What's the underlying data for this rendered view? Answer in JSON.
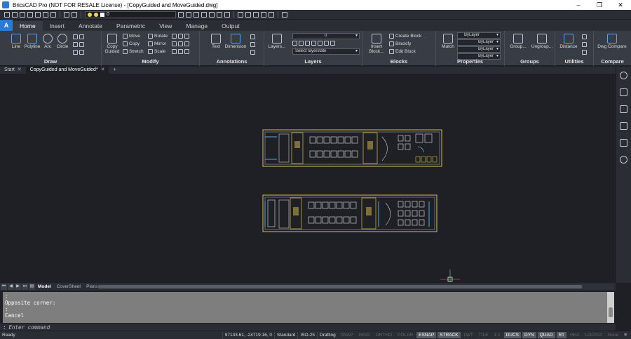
{
  "window": {
    "title": "BricsCAD Pro (NOT FOR RESALE License) - [CopyGuided and MoveGuided.dwg]",
    "minimize": "–",
    "maximize": "❐",
    "close": "✕"
  },
  "quick_access": {
    "layer_value": "0"
  },
  "ribbon_tabs": [
    "Home",
    "Insert",
    "Annotate",
    "Parametric",
    "View",
    "Manage",
    "Output"
  ],
  "ribbon": {
    "draw": {
      "title": "Draw",
      "tools": [
        "Line",
        "Polyline",
        "Arc",
        "Circle"
      ]
    },
    "modify": {
      "title": "Modify",
      "copy_guided": "Copy Guided",
      "items": [
        "Move",
        "Copy",
        "Stretch",
        "Rotate",
        "Mirror",
        "Scale"
      ]
    },
    "annotations": {
      "title": "Annotations",
      "tools": [
        "Text",
        "Dimension"
      ]
    },
    "layers": {
      "title": "Layers",
      "tool": "Layers...",
      "layer_value": "0",
      "layerstate_placeholder": "Select layerstate"
    },
    "blocks": {
      "title": "Blocks",
      "insert": "Insert Block...",
      "items": [
        "Create Block",
        "Blockify",
        "Edit Block"
      ]
    },
    "properties": {
      "title": "Properties",
      "match": "Match",
      "combos": [
        "ByLayer",
        "ByLayer",
        "ByLayer",
        "ByLayer"
      ]
    },
    "groups": {
      "title": "Groups",
      "tools": [
        "Group...",
        "Ungroup..."
      ]
    },
    "utilities": {
      "title": "Utilities",
      "tool": "Distance"
    },
    "compare": {
      "title": "Compare",
      "tool": "Dwg Compare"
    }
  },
  "doc_tabs": {
    "start": "Start",
    "active": "CopyGuided and MoveGuided*",
    "add": "+"
  },
  "layout_tabs": [
    "Model",
    "CoverSheet",
    "Plans",
    "+"
  ],
  "command": {
    "history": [
      ":",
      "Opposite corner:",
      ":",
      "Cancel"
    ],
    "prompt": ":",
    "placeholder": "Enter command"
  },
  "status": {
    "ready": "Ready",
    "coords": "97133.61, -24719.16, 0",
    "items": [
      "Standard",
      "ISO-25",
      "Drafting"
    ],
    "toggles": [
      {
        "label": "SNAP",
        "on": false
      },
      {
        "label": "GRID",
        "on": false
      },
      {
        "label": "ORTHO",
        "on": false
      },
      {
        "label": "POLAR",
        "on": false
      },
      {
        "label": "ESNAP",
        "on": true
      },
      {
        "label": "STRACK",
        "on": true
      },
      {
        "label": "LWT",
        "on": false
      },
      {
        "label": "TILE",
        "on": false
      },
      {
        "label": "1:1",
        "on": false
      },
      {
        "label": "DUCS",
        "on": true
      },
      {
        "label": "DYN",
        "on": true
      },
      {
        "label": "QUAD",
        "on": true
      },
      {
        "label": "RT",
        "on": true
      },
      {
        "label": "HKA",
        "on": false
      },
      {
        "label": "LOCKUI",
        "on": false
      },
      {
        "label": "None",
        "on": false
      }
    ]
  },
  "colors": {
    "accent": "#2b7bd6",
    "canvas": "#1e2026",
    "plan_border": "#d8c14a"
  }
}
